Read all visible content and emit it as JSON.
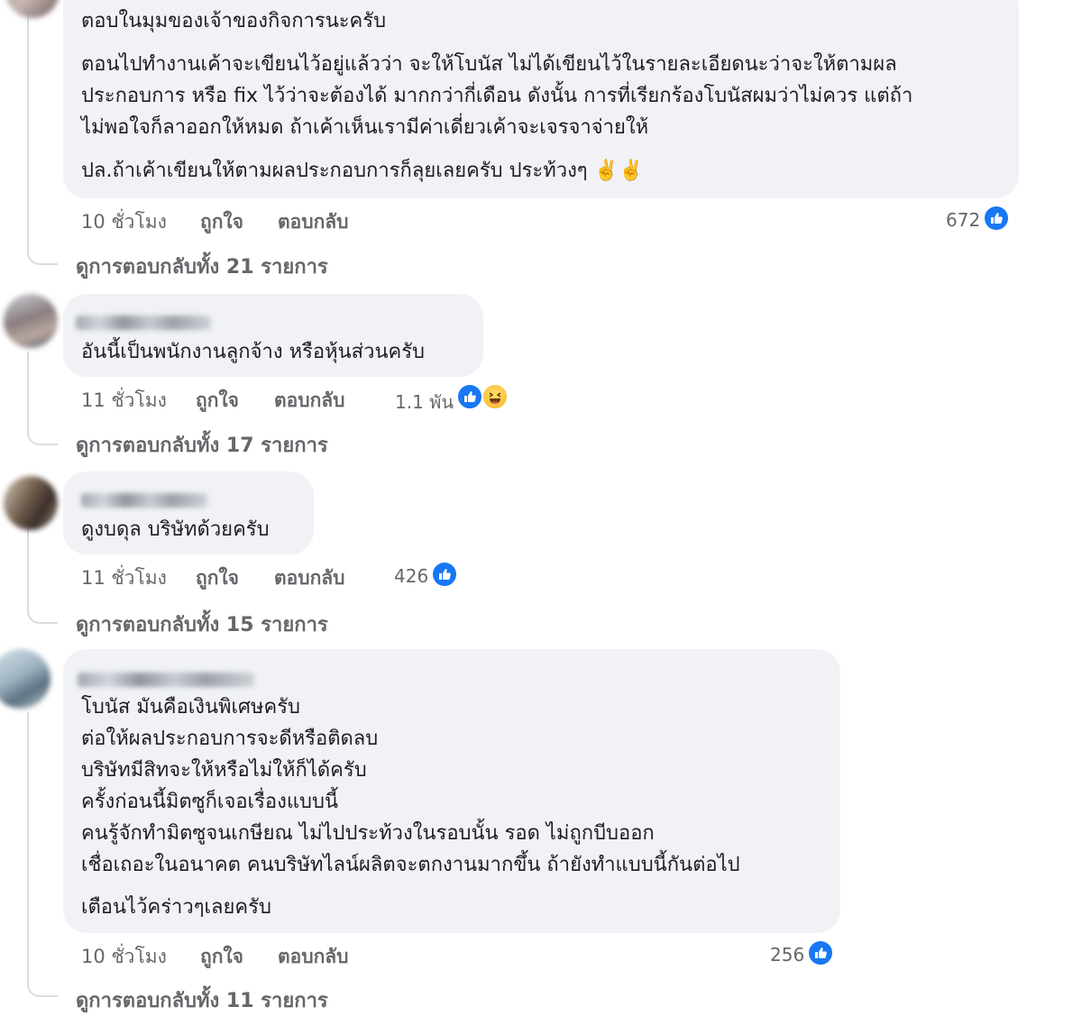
{
  "comments": [
    {
      "lines": [
        "ตอบในมุมของเจ้าของกิจการนะครับ",
        "ตอนไปทำงานเค้าจะเขียนไว้อยู่แล้วว่า จะให้โบนัส ไม่ได้เขียนไว้ในรายละเอียดนะว่าจะให้ตามผล",
        "ประกอบการ หรือ fix ไว้ว่าจะต้องได้ มากกว่ากี่เดือน ดังนั้น การที่เรียกร้องโบนัสผมว่าไม่ควร แต่ถ้า",
        "ไม่พอใจก็ลาออกให้หมด ถ้าเค้าเห็นเรามีค่าเดี่ยวเค้าจะเจรจาจ่ายให้",
        "ปล.ถ้าเค้าเขียนให้ตามผลประกอบการก็ลุยเลยครับ ประท้วงๆ"
      ],
      "emoji": "✌️✌️",
      "time": "10 ชั่วโมง",
      "like": "ถูกใจ",
      "reply": "ตอบกลับ",
      "reactions": "672",
      "view_replies": "ดูการตอบกลับทั้ง 21 รายการ"
    },
    {
      "lines": [
        "อันนี้เป็นพนักงานลูกจ้าง หรือหุ้นส่วนครับ"
      ],
      "time": "11 ชั่วโมง",
      "like": "ถูกใจ",
      "reply": "ตอบกลับ",
      "reactions": "1.1 พัน",
      "view_replies": "ดูการตอบกลับทั้ง 17 รายการ"
    },
    {
      "lines": [
        "ดูงบดุล บริษัทด้วยครับ"
      ],
      "time": "11 ชั่วโมง",
      "like": "ถูกใจ",
      "reply": "ตอบกลับ",
      "reactions": "426",
      "view_replies": "ดูการตอบกลับทั้ง 15 รายการ"
    },
    {
      "lines": [
        "โบนัส มันคือเงินพิเศษครับ",
        "ต่อให้ผลประกอบการจะดีหรือติดลบ",
        "บริษัทมีสิทจะให้หรือไม่ให้ก็ได้ครับ",
        "ครั้งก่อนนี้มิตซูก็เจอเรื่องแบบนี้",
        "คนรู้จักทำมิตซูจนเกษียณ ไม่ไปประท้วงในรอบนั้น รอด ไม่ถูกบีบออก",
        "เชื่อเถอะในอนาคต คนบริษัทไลน์ผลิตจะตกงานมากขึ้น ถ้ายังทำแบบนี้กันต่อไป",
        "เตือนไว้คร่าวๆเลยครับ"
      ],
      "time": "10 ชั่วโมง",
      "like": "ถูกใจ",
      "reply": "ตอบกลับ",
      "reactions": "256",
      "view_replies": "ดูการตอบกลับทั้ง 11 รายการ"
    }
  ],
  "colors": {
    "bubble": "#f0f2f5",
    "meta": "#65676b",
    "like_blue": "#1877f2",
    "thread": "#d9dbdf"
  },
  "icons": {
    "like": "like-icon",
    "haha": "haha-icon"
  }
}
